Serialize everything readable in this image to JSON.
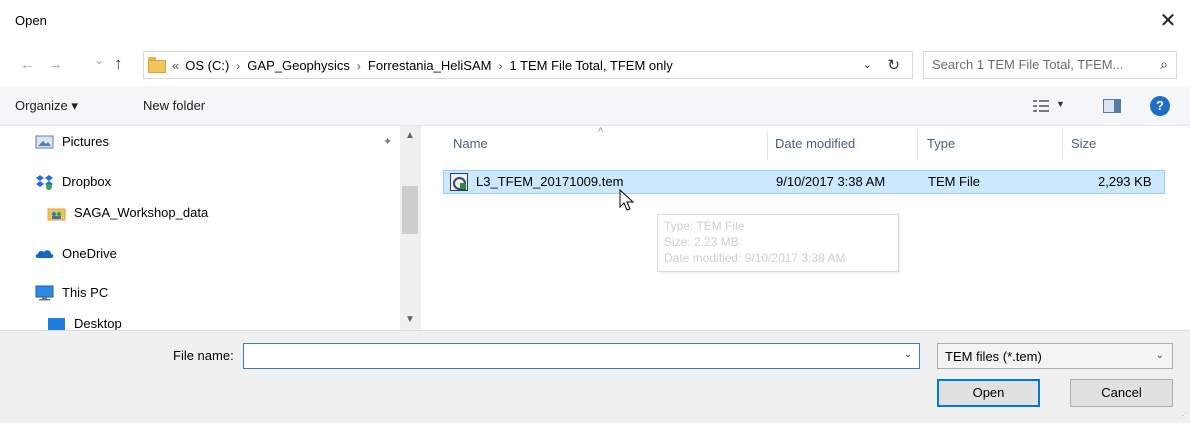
{
  "window": {
    "title": "Open",
    "close_glyph": "✕"
  },
  "nav_buttons": {
    "back": "←",
    "forward": "→",
    "recent": "⌄",
    "up": "↑"
  },
  "address": {
    "overflow": "«",
    "crumbs": [
      "OS (C:)",
      "GAP_Geophysics",
      "Forrestania_HeliSAM",
      "1 TEM File Total, TFEM only"
    ],
    "separator": "›",
    "dropdown_glyph": "⌄",
    "refresh_glyph": "↻"
  },
  "search": {
    "placeholder": "Search 1 TEM File Total, TFEM...",
    "icon": "search-icon"
  },
  "toolbar": {
    "organize_label": "Organize ▾",
    "new_folder_label": "New folder",
    "view_dropdown": "▼",
    "help": "?"
  },
  "sidebar": {
    "items": [
      {
        "label": "Pictures",
        "icon": "pictures-icon",
        "pinned": true
      },
      {
        "label": "Dropbox",
        "icon": "dropbox-icon"
      },
      {
        "label": "SAGA_Workshop_data",
        "icon": "shared-folder-icon"
      },
      {
        "label": "OneDrive",
        "icon": "onedrive-icon"
      },
      {
        "label": "This PC",
        "icon": "this-pc-icon"
      },
      {
        "label": "Desktop",
        "icon": "desktop-folder-icon"
      }
    ],
    "pin_glyph": "📌"
  },
  "columns": {
    "name": "Name",
    "date_modified": "Date modified",
    "type": "Type",
    "size": "Size",
    "sort_glyph": "^"
  },
  "files": [
    {
      "name": "L3_TFEM_20171009.tem",
      "date_modified": "9/10/2017 3:38 AM",
      "type": "TEM File",
      "size": "2,293 KB",
      "icon": "tem-file-icon"
    }
  ],
  "tooltip": {
    "type": "Type: TEM File",
    "size": "Size: 2.23 MB",
    "date": "Date modified: 9/10/2017 3:38 AM"
  },
  "bottom": {
    "file_name_label": "File name:",
    "file_name_value": "",
    "filter_value": "TEM files (*.tem)",
    "dd_glyph": "⌄",
    "open_label": "Open",
    "cancel_label": "Cancel"
  },
  "colors": {
    "accent": "#0078d7",
    "selection": "#cce8ff",
    "selection_border": "#99d1ff",
    "header_text": "#4c607a"
  }
}
